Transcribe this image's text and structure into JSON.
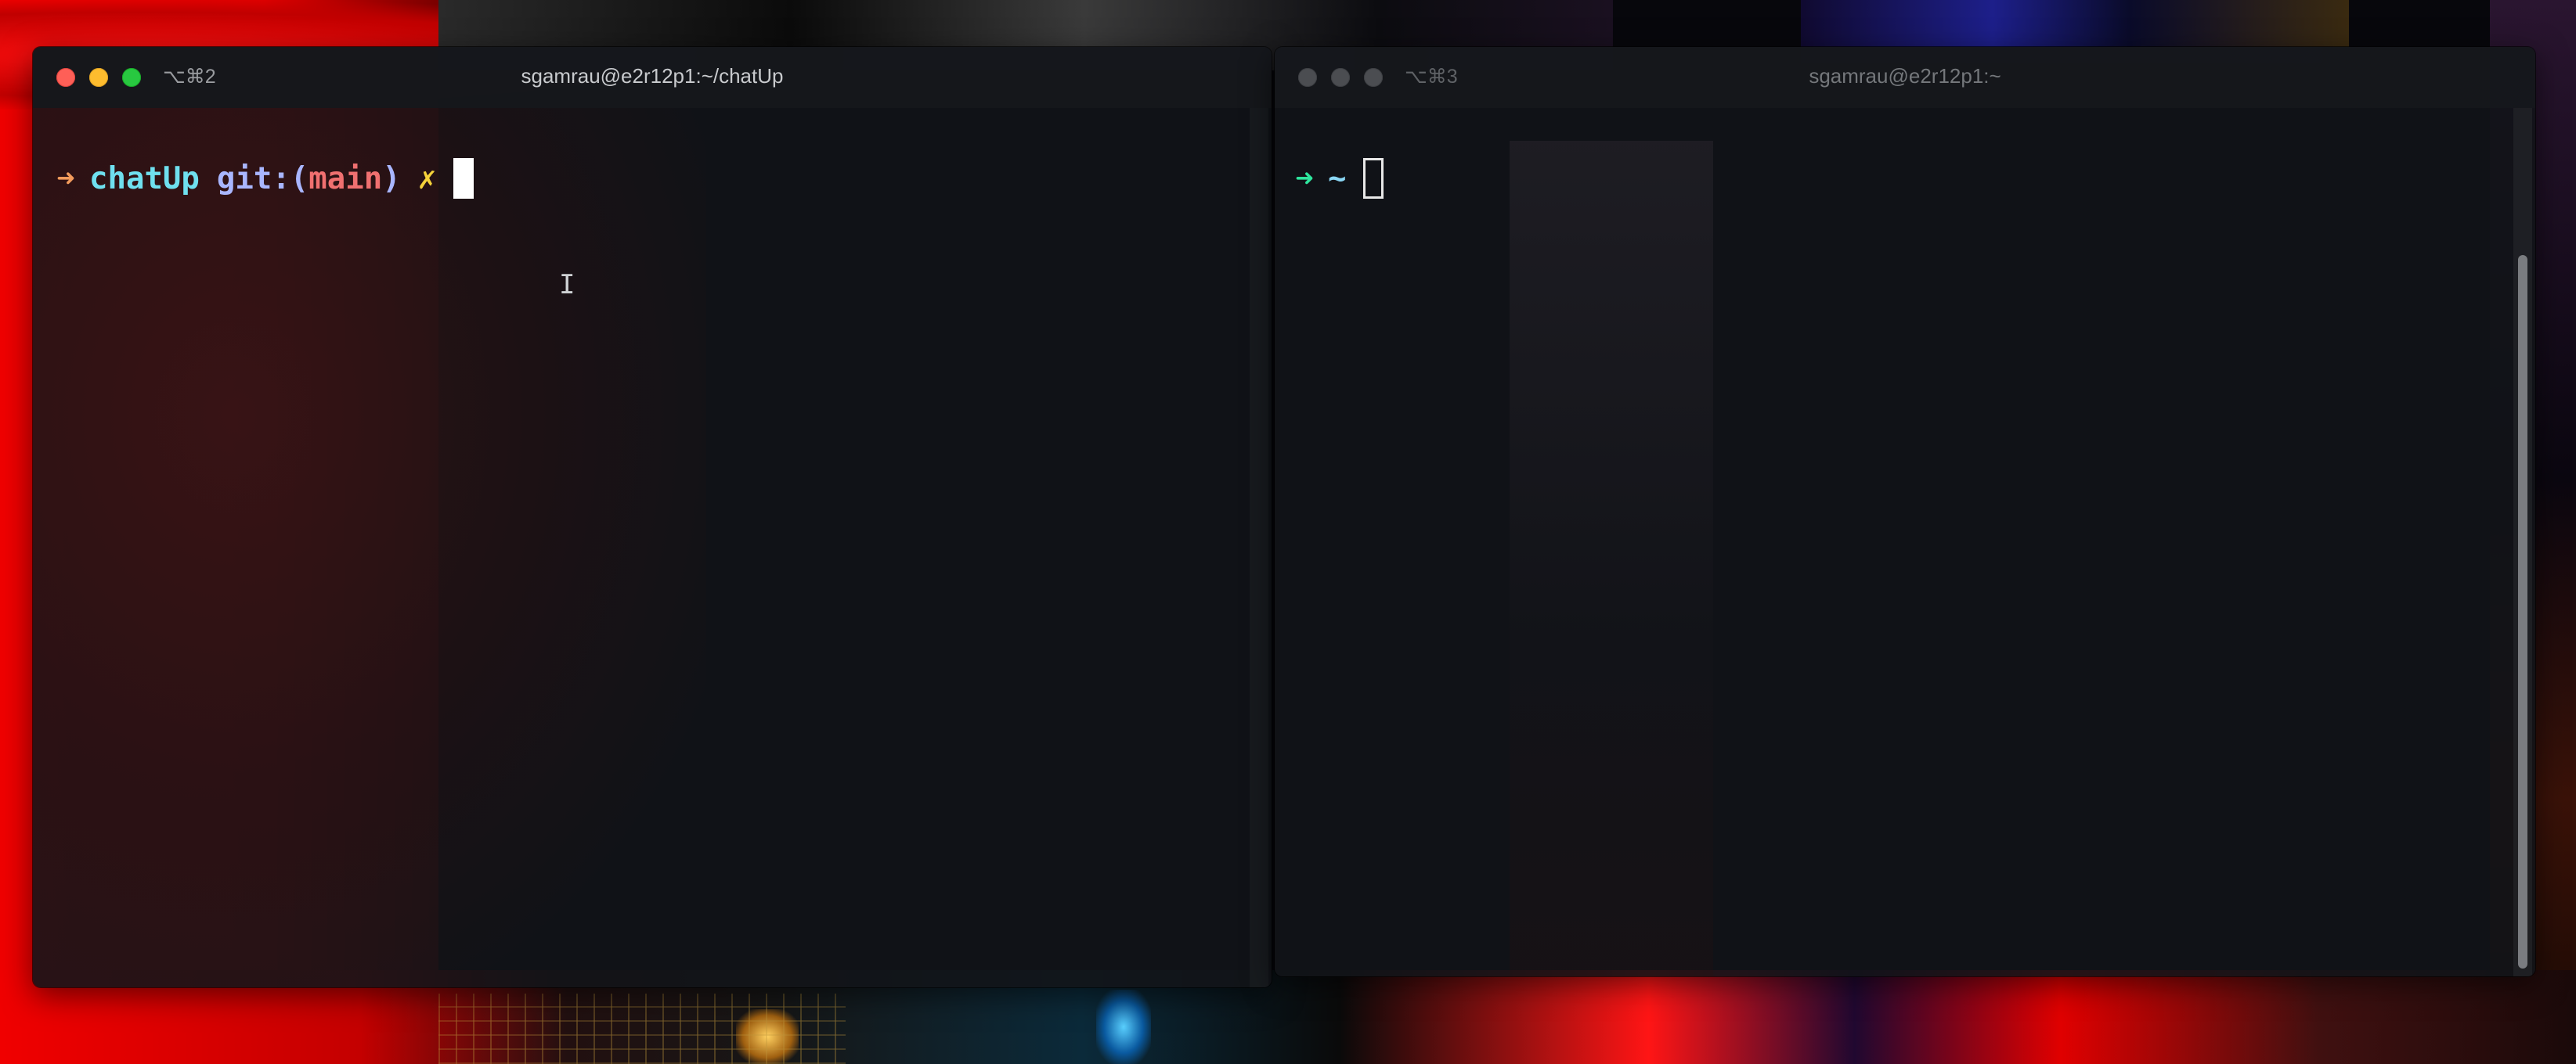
{
  "colors": {
    "arrow_left": "#f29b5c",
    "arrow_right": "#2ee59d",
    "dir": "#6fe0ef",
    "git": "#a9b6ff",
    "branch": "#f07070",
    "dirty": "#f5d23a",
    "home": "#8ad7f5"
  },
  "left_window": {
    "tab_shortcut": "⌥⌘2",
    "title": "sgamrau@e2r12p1:~/chatUp",
    "prompt": {
      "arrow": "➜",
      "dir": "chatUp",
      "git_label": "git:(",
      "branch": "main",
      "git_close": ")",
      "dirty": "✗"
    },
    "ibeam_icon": "I"
  },
  "right_window": {
    "tab_shortcut": "⌥⌘3",
    "title": "sgamrau@e2r12p1:~",
    "prompt": {
      "arrow": "➜",
      "dir": "~"
    }
  }
}
